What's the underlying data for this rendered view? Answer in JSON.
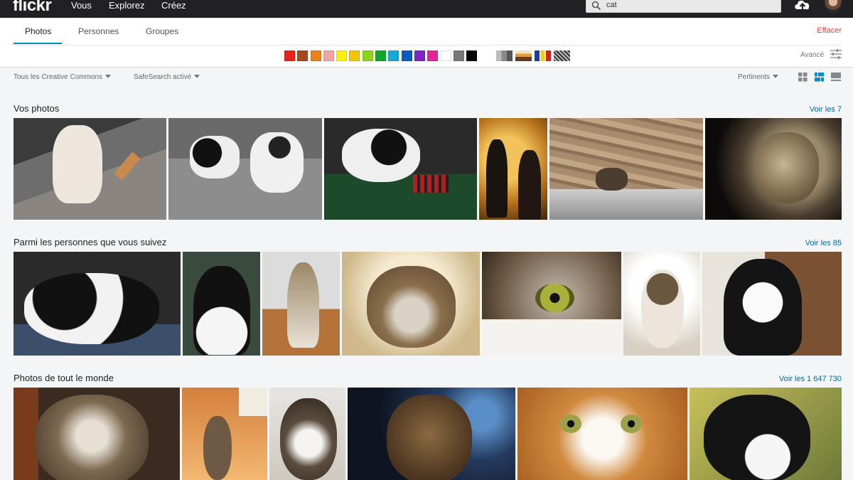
{
  "header": {
    "logo": "flickr",
    "nav": [
      "Vous",
      "Explorez",
      "Créez"
    ],
    "search_value": "cat"
  },
  "subnav": {
    "tabs": [
      "Photos",
      "Personnes",
      "Groupes"
    ],
    "clear": "Effacer",
    "advanced": "Avancé",
    "colors": [
      "#e8231a",
      "#a34a1c",
      "#f07e1a",
      "#f4a3a3",
      "#fff200",
      "#f4c400",
      "#8ed41c",
      "#12a62a",
      "#1ba7d6",
      "#0a5cc4",
      "#7b27c6",
      "#e6249a",
      "#ffffff",
      "#777777",
      "#000000"
    ]
  },
  "filters": {
    "license": "Tous les Creative Commons",
    "safesearch": "SafeSearch activé",
    "sort": "Pertinents"
  },
  "sections": [
    {
      "title": "Vos photos",
      "link": "Voir les 7"
    },
    {
      "title": "Parmi les personnes que vous suivez",
      "link": "Voir les 85"
    },
    {
      "title": "Photos de tout le monde",
      "link": "Voir les 1 647 730"
    }
  ],
  "photos": {
    "row1": [
      "white-cat-on-gravel-icon",
      "cat-and-dog-bw-icon",
      "cat-on-poker-table-icon",
      "cat-figurines-icon",
      "cat-on-stone-wall-icon",
      "tabby-in-sunlight-icon"
    ],
    "row2": [
      "black-white-cat-on-blue-icon",
      "tuxedo-cat-icon",
      "tabby-on-desk-icon",
      "tabby-on-blanket-icon",
      "cat-eye-closeup-icon",
      "cat-on-white-cushion-icon",
      "cat-by-bookshelf-icon"
    ],
    "row3": [
      "long-hair-cat-icon",
      "cat-reaching-plant-icon",
      "tabby-white-cat-icon",
      "tabby-bokeh-icon",
      "orange-white-cat-icon",
      "black-white-cat-yellow-icon"
    ]
  }
}
